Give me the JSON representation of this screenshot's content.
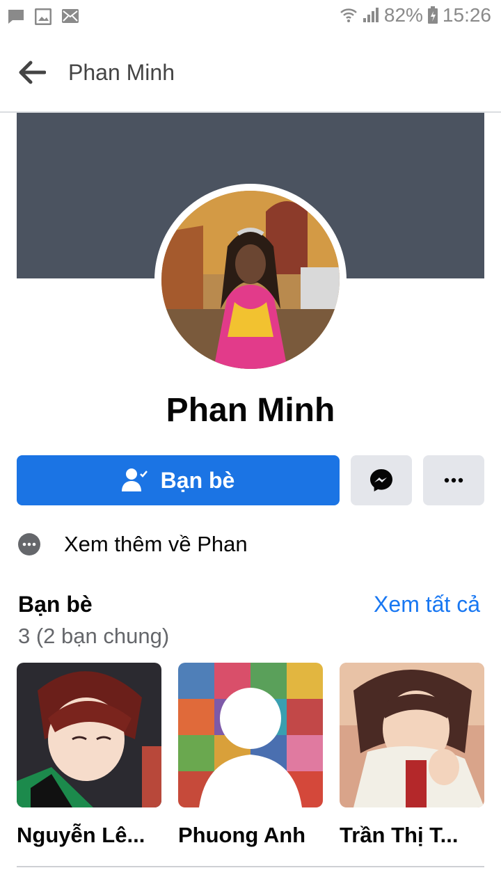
{
  "status_bar": {
    "battery": "82%",
    "time": "15:26",
    "icons": [
      "message-icon",
      "image-icon",
      "mail-icon",
      "wifi-icon",
      "signal-icon",
      "battery-icon"
    ]
  },
  "header": {
    "title": "Phan Minh"
  },
  "profile": {
    "name": "Phan Minh",
    "cover_color": "#4b5360"
  },
  "actions": {
    "friends_label": "Bạn bè",
    "accent_color": "#1b74e4"
  },
  "see_more": {
    "label": "Xem thêm về Phan"
  },
  "friends_section": {
    "title": "Bạn bè",
    "see_all": "Xem tất cả",
    "count": "3 (2 bạn chung)",
    "items": [
      {
        "name": "Nguyễn Lê..."
      },
      {
        "name": "Phuong Anh"
      },
      {
        "name": "Trần Thị T..."
      }
    ]
  }
}
